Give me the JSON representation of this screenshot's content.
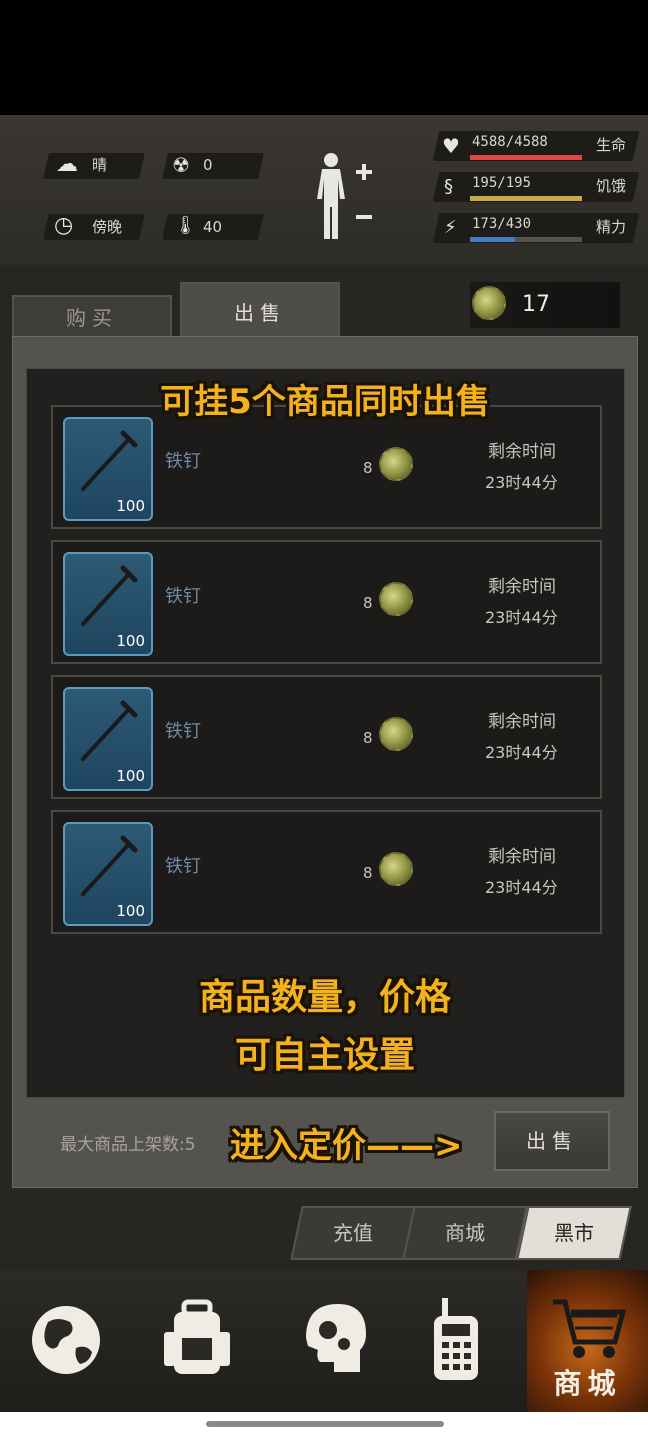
{
  "hud": {
    "weather": "晴",
    "radiation": "0",
    "time_of_day": "傍晚",
    "temperature": "40",
    "vitals": [
      {
        "label": "生命",
        "value": "4588/4588",
        "fraction": 1.0,
        "color": "#d94a44",
        "icon": "heart-icon"
      },
      {
        "label": "饥饿",
        "value": "195/195",
        "fraction": 1.0,
        "color": "#c9a84a",
        "icon": "stomach-icon"
      },
      {
        "label": "精力",
        "value": "173/430",
        "fraction": 0.4,
        "color": "#3f7fc1",
        "icon": "energy-icon"
      }
    ]
  },
  "tabs": {
    "buy": "购买",
    "sell": "出售",
    "active": "sell"
  },
  "money": "17",
  "items": [
    {
      "name": "铁钉",
      "qty": "100",
      "price": "8",
      "remain_label": "剩余时间",
      "remain_time": "23时44分"
    },
    {
      "name": "铁钉",
      "qty": "100",
      "price": "8",
      "remain_label": "剩余时间",
      "remain_time": "23时44分"
    },
    {
      "name": "铁钉",
      "qty": "100",
      "price": "8",
      "remain_label": "剩余时间",
      "remain_time": "23时44分"
    },
    {
      "name": "铁钉",
      "qty": "100",
      "price": "8",
      "remain_label": "剩余时间",
      "remain_time": "23时44分"
    }
  ],
  "overlays": {
    "top": "可挂5个商品同时出售",
    "mid_line1": "商品数量，价格",
    "mid_line2": "可自主设置",
    "arrow": "进入定价——>"
  },
  "footer": {
    "max_items": "最大商品上架数:5",
    "sell_button": "出售"
  },
  "shop_tabs": {
    "recharge": "充值",
    "mall": "商城",
    "black_market": "黑市",
    "active": "black_market"
  },
  "bottom_nav": {
    "items": [
      "globe-icon",
      "backpack-icon",
      "head-gear-icon",
      "radio-icon",
      "cart-icon"
    ],
    "shop_label": "商城"
  }
}
